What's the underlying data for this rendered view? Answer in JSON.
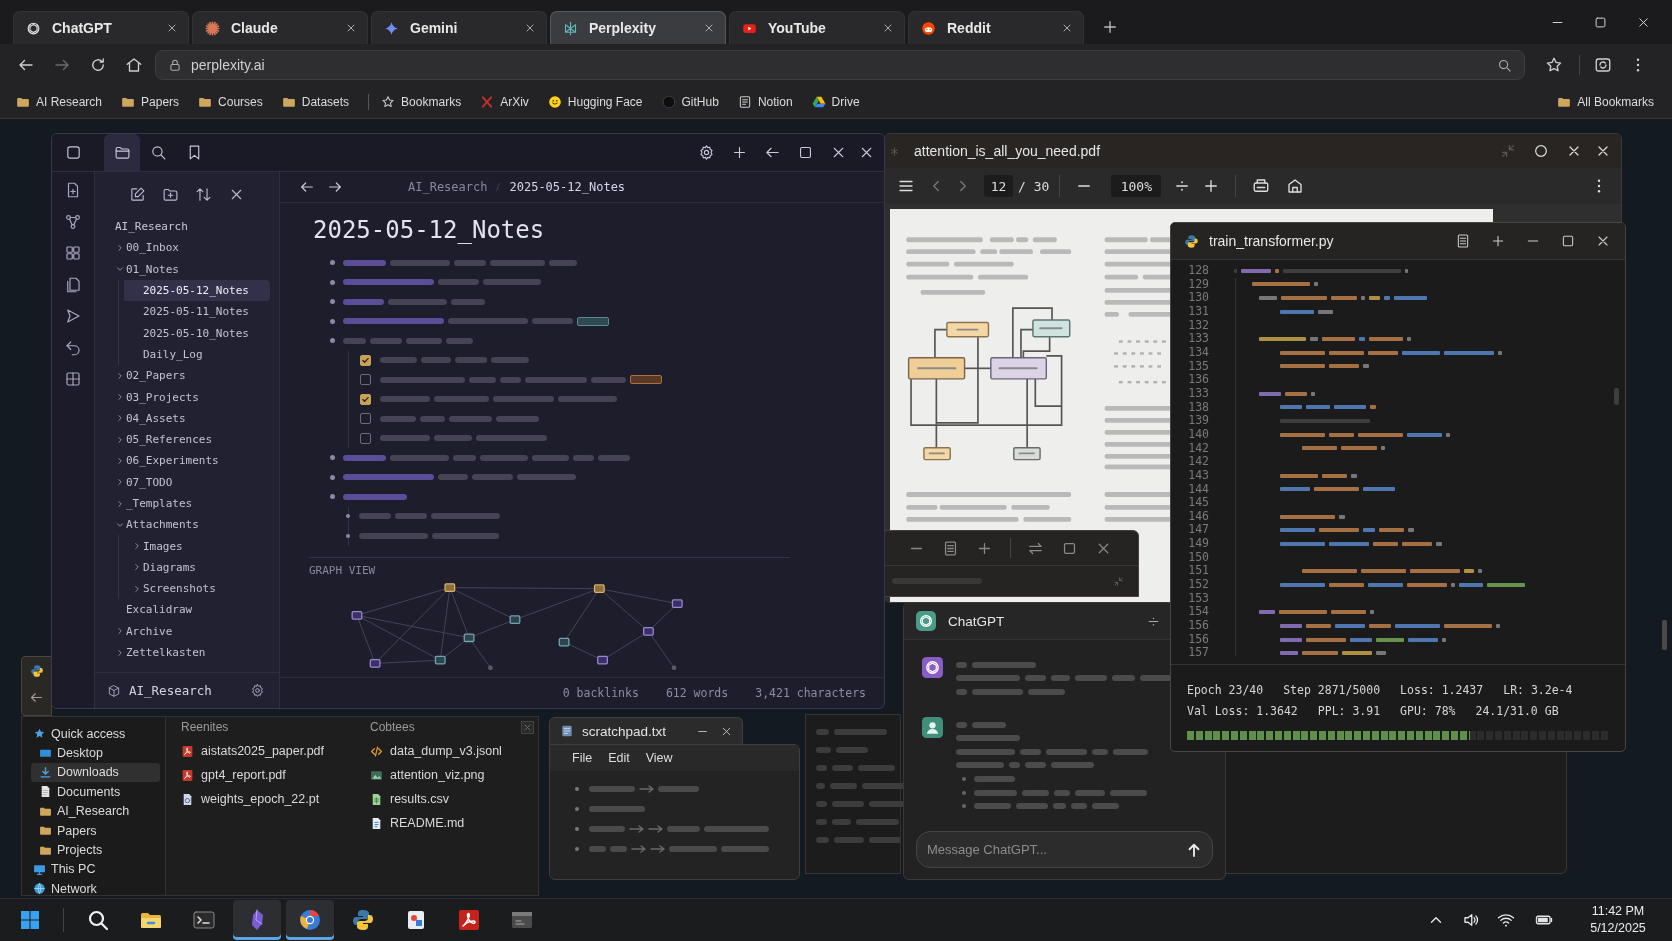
{
  "browser": {
    "tabs": [
      {
        "label": "ChatGPT",
        "kind": "knot",
        "selected": false
      },
      {
        "label": "Claude",
        "kind": "burst",
        "selected": false
      },
      {
        "label": "Gemini",
        "kind": "sparkle",
        "selected": false
      },
      {
        "label": "Perplexity",
        "kind": "lattice",
        "selected": true
      },
      {
        "label": "YouTube",
        "kind": "play",
        "selected": false
      },
      {
        "label": "Reddit",
        "kind": "alien",
        "selected": false
      }
    ],
    "forward": {
      "disabled": true
    },
    "address": "perplexity.ai",
    "bookmarks": [
      {
        "label": "AI Research",
        "kind": "folder"
      },
      {
        "label": "Papers",
        "kind": "folder"
      },
      {
        "label": "Courses",
        "kind": "folder"
      },
      {
        "label": "Datasets",
        "kind": "folder"
      },
      {
        "label": "Bookmarks",
        "kind": "star"
      },
      {
        "label": "ArXiv",
        "kind": "paper"
      },
      {
        "label": "Hugging Face",
        "kind": "smiley"
      },
      {
        "label": "GitHub",
        "kind": "dot"
      },
      {
        "label": "Notion",
        "kind": "page"
      },
      {
        "label": "Drive",
        "kind": "triangle"
      }
    ],
    "all_bookmarks": "All Bookmarks"
  },
  "notes": {
    "sidebar_tabs": [
      {
        "kind": "files",
        "selected": true
      },
      {
        "kind": "search",
        "selected": false
      },
      {
        "kind": "bookmarks",
        "selected": false
      }
    ],
    "vault_root": "AI_Research",
    "tree": [
      {
        "label": "00_Inbox",
        "kind": "folder",
        "expanded": false,
        "selected": false
      },
      {
        "label": "01_Notes",
        "kind": "folder",
        "expanded": true,
        "selected": false,
        "children": [
          {
            "label": "2025-05-12_Notes",
            "kind": "file",
            "selected": true
          },
          {
            "label": "2025-05-11_Notes",
            "kind": "file",
            "selected": false
          },
          {
            "label": "2025-05-10_Notes",
            "kind": "file",
            "selected": false
          },
          {
            "label": "Daily_Log",
            "kind": "file",
            "selected": false
          }
        ]
      },
      {
        "label": "02_Papers",
        "kind": "folder",
        "expanded": false,
        "selected": false
      },
      {
        "label": "03_Projects",
        "kind": "folder",
        "expanded": false,
        "selected": false
      },
      {
        "label": "04_Assets",
        "kind": "folder",
        "expanded": false,
        "selected": false
      },
      {
        "label": "05_References",
        "kind": "folder",
        "expanded": false,
        "selected": false
      },
      {
        "label": "06_Experiments",
        "kind": "folder",
        "expanded": false,
        "selected": false
      },
      {
        "label": "07_TODO",
        "kind": "folder",
        "expanded": false,
        "selected": false
      },
      {
        "label": "_Templates",
        "kind": "folder",
        "expanded": false,
        "selected": false
      },
      {
        "label": "Attachments",
        "kind": "folder",
        "expanded": true,
        "selected": false,
        "children": [
          {
            "label": "Images",
            "kind": "folder",
            "expanded": false,
            "selected": false
          },
          {
            "label": "Diagrams",
            "kind": "folder",
            "expanded": false,
            "selected": false
          },
          {
            "label": "Screenshots",
            "kind": "folder",
            "expanded": false,
            "selected": false
          }
        ]
      },
      {
        "label": "Excalidraw",
        "kind": "file",
        "selected": false
      },
      {
        "label": "Archive",
        "kind": "folder",
        "expanded": false,
        "selected": false
      },
      {
        "label": "Zettelkasten",
        "kind": "folder",
        "expanded": false,
        "selected": false
      }
    ],
    "vault_switcher": "AI_Research",
    "breadcrumb": [
      "AI_Research",
      "2025-05-12_Notes"
    ],
    "title": "2025-05-12_Notes",
    "tasks": [
      {
        "checked": true
      },
      {
        "checked": false
      },
      {
        "checked": true
      },
      {
        "checked": false
      },
      {
        "checked": false
      }
    ],
    "graph_label": "GRAPH VIEW",
    "footer": [
      "0 backlinks",
      "612 words",
      "3,421 characters"
    ]
  },
  "pdf": {
    "title": "attention_is_all_you_need.pdf",
    "page": "12",
    "page_total": "/ 30",
    "zoom": "100%"
  },
  "editor": {
    "title": "train_transformer.py",
    "line_numbers": [
      "128",
      "129",
      "130",
      "131",
      "132",
      "133",
      "134",
      "135",
      "136",
      "133",
      "138",
      "139",
      "140",
      "142",
      "142",
      "143",
      "144",
      "145",
      "146",
      "147",
      "149",
      "150",
      "151",
      "152",
      "153",
      "154",
      "156",
      "156",
      "157"
    ],
    "stats": [
      [
        "Epoch 23/40",
        "Step 2871/5000",
        "Loss: 1.2437",
        "LR: 3.2e-4"
      ],
      [
        "Val Loss: 1.3642",
        "PPL: 3.91",
        "GPU: 78%",
        "24.1/31.0 GB"
      ]
    ],
    "progress": {
      "level": 0.67
    }
  },
  "chat": {
    "title": "ChatGPT",
    "messages": [
      {
        "kind": "assistant"
      },
      {
        "kind": "user"
      }
    ],
    "placeholder": "Message ChatGPT..."
  },
  "explorer": {
    "nav": [
      {
        "label": "Quick access",
        "kind": "star",
        "selected": false,
        "children": [
          {
            "label": "Desktop",
            "kind": "desktop",
            "selected": false
          },
          {
            "label": "Downloads",
            "kind": "download",
            "selected": true
          },
          {
            "label": "Documents",
            "kind": "document",
            "selected": false
          },
          {
            "label": "AI_Research",
            "kind": "folder",
            "selected": false
          },
          {
            "label": "Papers",
            "kind": "folder",
            "selected": false
          },
          {
            "label": "Projects",
            "kind": "folder",
            "selected": false
          }
        ]
      },
      {
        "label": "This PC",
        "kind": "pc",
        "selected": false
      },
      {
        "label": "Network",
        "kind": "network",
        "selected": false
      }
    ],
    "groups": [
      {
        "heading": "Reenites",
        "files": [
          {
            "name": "aistats2025_paper.pdf",
            "kind": "pdf"
          },
          {
            "name": "gpt4_report.pdf",
            "kind": "pdf"
          },
          {
            "name": "weights_epoch_22.pt",
            "kind": "binary"
          }
        ]
      },
      {
        "heading": "Cobtees",
        "files": [
          {
            "name": "data_dump_v3.jsonl",
            "kind": "code"
          },
          {
            "name": "attention_viz.png",
            "kind": "image"
          },
          {
            "name": "results.csv",
            "kind": "sheet"
          },
          {
            "name": "README.md",
            "kind": "markdown"
          }
        ]
      }
    ]
  },
  "scratchpad": {
    "title": "scratchpad.txt",
    "menu": [
      "File",
      "Edit",
      "View"
    ]
  },
  "taskbar": {
    "apps": [
      {
        "kind": "start",
        "active": false
      },
      {
        "kind": "search",
        "active": false
      },
      {
        "kind": "files",
        "active": false
      },
      {
        "kind": "terminal",
        "active": false
      },
      {
        "kind": "crystal",
        "active": true
      },
      {
        "kind": "globe",
        "active": true
      },
      {
        "kind": "python",
        "active": false
      },
      {
        "kind": "paint",
        "active": false
      },
      {
        "kind": "acrobat",
        "active": false
      },
      {
        "kind": "window",
        "active": false
      }
    ],
    "time": "11:42 PM",
    "date": "5/12/2025"
  }
}
